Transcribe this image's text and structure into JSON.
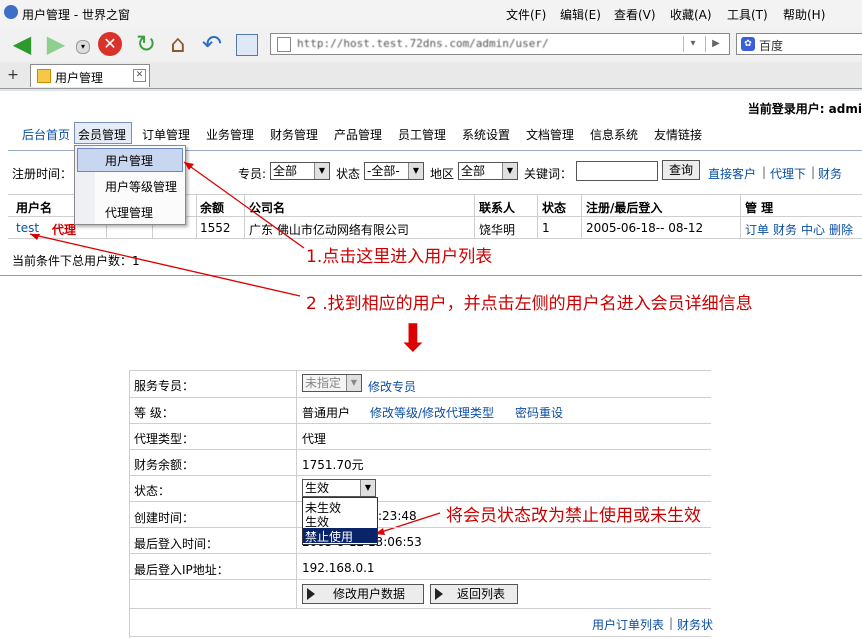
{
  "window": {
    "title": "用户管理 - 世界之窗"
  },
  "menubar": [
    "文件(F)",
    "编辑(E)",
    "查看(V)",
    "收藏(A)",
    "工具(T)",
    "帮助(H)"
  ],
  "toolbar": {
    "address": "http://host.test.72dns.com/admin/user/",
    "search_placeholder": "百度"
  },
  "tab": {
    "label": "用户管理",
    "new_tab": "+"
  },
  "header": {
    "login_label": "当前登录用户: admi"
  },
  "nav": [
    "后台首页",
    "会员管理",
    "订单管理",
    "业务管理",
    "财务管理",
    "产品管理",
    "员工管理",
    "系统设置",
    "文档管理",
    "信息系统",
    "友情链接"
  ],
  "submenu": [
    "用户管理",
    "用户等级管理",
    "代理管理"
  ],
  "filter": {
    "date_label": "注册时间：",
    "staff_label": "专员:",
    "staff_value": "全部",
    "status_label": "状态",
    "status_value": "-全部-",
    "region_label": "地区",
    "region_value": "全部",
    "keyword_label": "关键词：",
    "query_button": "查询",
    "links": [
      "直接客户",
      "代理下",
      "财务"
    ]
  },
  "table": {
    "headers": [
      "用户名",
      "余额",
      "公司名",
      "联系人",
      "状态",
      "注册/最后登入",
      "管 理"
    ],
    "row": {
      "username": "test",
      "type": "代理",
      "balance": "1552",
      "company": "广东 佛山市亿动网络有限公司",
      "contact": "饶华明",
      "status": "1",
      "dates": "2005-06-18-- 08-12",
      "actions": [
        "订单",
        "财务",
        "中心",
        "删除"
      ]
    },
    "total_label": "当前条件下总用户数：1"
  },
  "annotations": {
    "step1": "1.点击这里进入用户列表",
    "step2": "2 .找到相应的用户，并点击左侧的用户名进入会员详细信息",
    "arrow": "⬇",
    "step3": "将会员状态改为禁止使用或未生效"
  },
  "detail": {
    "staff_label": "服务专员：",
    "staff_value": "未指定",
    "staff_link": "修改专员",
    "level_label": "等 级：",
    "level_value": "普通用户",
    "level_link": "修改等级/修改代理类型",
    "reset_link": "密码重设",
    "agent_label": "代理类型：",
    "agent_value": "代理",
    "balance_label": "财务余额：",
    "balance_value": "1751.70元",
    "status_label": "状态：",
    "status_value": "生效",
    "status_options": [
      "未生效",
      "生效",
      "禁止使用"
    ],
    "created_label": "创建时间：",
    "created_value": ":23:48",
    "lastlogin_label": "最后登入时间：",
    "lastlogin_value": "2005-8-12 13:06:53",
    "lastip_label": "最后登入IP地址：",
    "lastip_value": "192.168.0.1",
    "modify_button": "修改用户数据",
    "back_button": "返回列表",
    "footer_links": [
      "用户订单列表",
      "财务状"
    ]
  }
}
